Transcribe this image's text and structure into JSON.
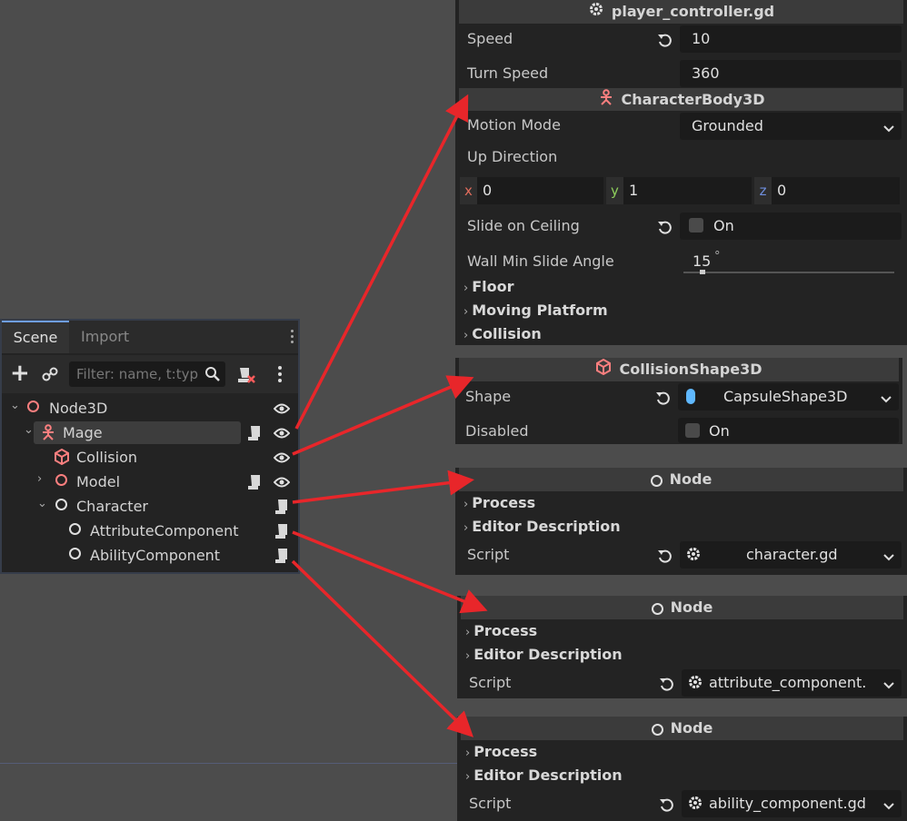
{
  "scene_dock": {
    "tabs": [
      {
        "label": "Scene"
      },
      {
        "label": "Import"
      }
    ],
    "filter_placeholder": "Filter: name, t:typ",
    "nodes": [
      {
        "label": "Node3D",
        "icon": "node3d-icon",
        "color": "#fc7f7f"
      },
      {
        "label": "Mage",
        "icon": "character-body-icon",
        "color": "#fc7f7f"
      },
      {
        "label": "Collision",
        "icon": "collision-shape-icon",
        "color": "#fc7f7f"
      },
      {
        "label": "Model",
        "icon": "node3d-icon",
        "color": "#fc7f7f"
      },
      {
        "label": "Character",
        "icon": "node-icon",
        "color": "#e0e0e0"
      },
      {
        "label": "AttributeComponent",
        "icon": "node-icon",
        "color": "#e0e0e0"
      },
      {
        "label": "AbilityComponent",
        "icon": "node-icon",
        "color": "#e0e0e0"
      }
    ]
  },
  "inspector_main": {
    "script_title": "player_controller.gd",
    "speed_label": "Speed",
    "speed_value": "10",
    "turn_speed_label": "Turn Speed",
    "turn_speed_value": "360",
    "body_title": "CharacterBody3D",
    "motion_mode_label": "Motion Mode",
    "motion_mode_value": "Grounded",
    "up_direction_label": "Up Direction",
    "up_x_label": "x",
    "up_x": "0",
    "up_y_label": "y",
    "up_y": "1",
    "up_z_label": "z",
    "up_z": "0",
    "slide_ceiling_label": "Slide on Ceiling",
    "slide_ceiling_value": "On",
    "wall_min_label": "Wall Min Slide Angle",
    "wall_min_value": "15",
    "wall_min_unit": "°",
    "sections": [
      "Floor",
      "Moving Platform",
      "Collision"
    ]
  },
  "inspector_collision": {
    "title": "CollisionShape3D",
    "shape_label": "Shape",
    "shape_value": "CapsuleShape3D",
    "disabled_label": "Disabled",
    "disabled_value": "On"
  },
  "node_panels": [
    {
      "title": "Node",
      "sections": [
        "Process",
        "Editor Description"
      ],
      "script_label": "Script",
      "script_value": "character.gd"
    },
    {
      "title": "Node",
      "sections": [
        "Process",
        "Editor Description"
      ],
      "script_label": "Script",
      "script_value": "attribute_component."
    },
    {
      "title": "Node",
      "sections": [
        "Process",
        "Editor Description"
      ],
      "script_label": "Script",
      "script_value": "ability_component.gd"
    }
  ],
  "colors": {
    "arrow": "#e8262a",
    "accent": "#6f9ee6",
    "node3d": "#fc7f7f"
  }
}
